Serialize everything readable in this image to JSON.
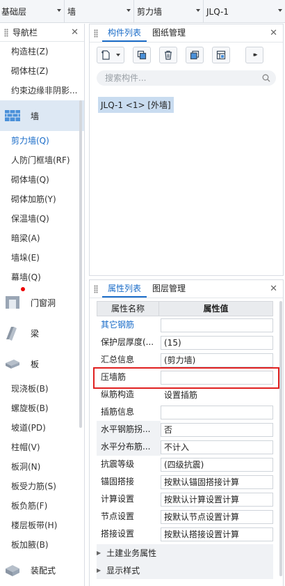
{
  "topbar": {
    "dropdowns": [
      "基础层",
      "墙",
      "剪力墙",
      "JLQ-1"
    ]
  },
  "nav": {
    "title": "导航栏",
    "items_top": [
      "构造柱(Z)",
      "砌体柱(Z)",
      "约束边缘非阴影..."
    ],
    "cat_wall": "墙",
    "wall_items": [
      "剪力墙(Q)",
      "人防门框墙(RF)",
      "砌体墙(Q)",
      "砌体加筋(Y)",
      "保温墙(Q)",
      "暗梁(A)",
      "墙垛(E)",
      "幕墙(Q)"
    ],
    "cat_door": "门窗洞",
    "cat_beam": "梁",
    "cat_slab": "板",
    "slab_items": [
      "现浇板(B)",
      "螺旋板(B)",
      "坡道(PD)",
      "柱帽(V)",
      "板洞(N)",
      "板受力筋(S)",
      "板负筋(F)",
      "楼层板带(H)",
      "板加腋(B)"
    ],
    "cat_assembly": "装配式"
  },
  "components": {
    "tabs": [
      "构件列表",
      "图纸管理"
    ],
    "search_placeholder": "搜索构件...",
    "selected_item": "JLQ-1 <1> [外墙]"
  },
  "properties": {
    "tabs": [
      "属性列表",
      "图层管理"
    ],
    "header_name": "属性名称",
    "header_value": "属性值",
    "rows": [
      {
        "name": "其它钢筋",
        "value": ""
      },
      {
        "name": "保护层厚度(...",
        "value": "(15)"
      },
      {
        "name": "汇总信息",
        "value": "(剪力墙)"
      },
      {
        "name": "压墙筋",
        "value": ""
      },
      {
        "name": "纵筋构造",
        "value": "设置插筋"
      },
      {
        "name": "插筋信息",
        "value": ""
      },
      {
        "name": "水平钢筋拐...",
        "value": "否"
      },
      {
        "name": "水平分布筋...",
        "value": "不计入"
      },
      {
        "name": "抗震等级",
        "value": "(四级抗震)"
      },
      {
        "name": "锚固搭接",
        "value": "按默认锚固搭接计算"
      },
      {
        "name": "计算设置",
        "value": "按默认计算设置计算"
      },
      {
        "name": "节点设置",
        "value": "按默认节点设置计算"
      },
      {
        "name": "搭接设置",
        "value": "按默认搭接设置计算"
      }
    ],
    "groups": [
      "土建业务属性",
      "显示样式"
    ]
  },
  "colors": {
    "accent": "#1a6cc8",
    "highlight": "#e02020",
    "selected_bg": "#c9dcf0"
  }
}
